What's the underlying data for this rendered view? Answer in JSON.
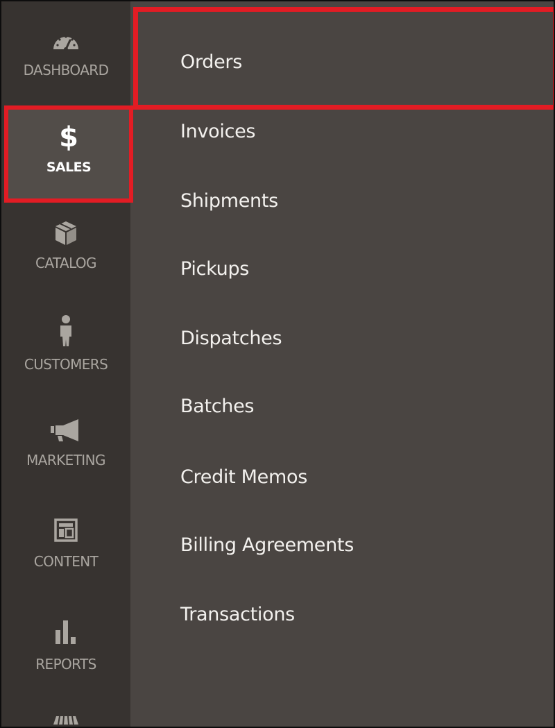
{
  "sidebar": {
    "items": [
      {
        "id": "dashboard",
        "label": "DASHBOARD",
        "icon": "speedometer-icon"
      },
      {
        "id": "sales",
        "label": "SALES",
        "icon": "dollar-icon",
        "active": true
      },
      {
        "id": "catalog",
        "label": "CATALOG",
        "icon": "cube-icon"
      },
      {
        "id": "customers",
        "label": "CUSTOMERS",
        "icon": "person-icon"
      },
      {
        "id": "marketing",
        "label": "MARKETING",
        "icon": "megaphone-icon"
      },
      {
        "id": "content",
        "label": "CONTENT",
        "icon": "layout-icon"
      },
      {
        "id": "reports",
        "label": "REPORTS",
        "icon": "bar-chart-icon"
      },
      {
        "id": "stores",
        "label": "",
        "icon": "storefront-icon"
      }
    ]
  },
  "submenu": {
    "items": [
      {
        "label": "Orders",
        "highlighted": true
      },
      {
        "label": "Invoices"
      },
      {
        "label": "Shipments"
      },
      {
        "label": "Pickups"
      },
      {
        "label": "Dispatches"
      },
      {
        "label": "Batches"
      },
      {
        "label": "Credit Memos"
      },
      {
        "label": "Billing Agreements"
      },
      {
        "label": "Transactions"
      }
    ]
  },
  "colors": {
    "highlight": "#e21c24",
    "sidebar_bg": "#373330",
    "panel_bg": "#4a4542",
    "active_bg": "#524d49",
    "text_muted": "#aaa6a0",
    "text_light": "#f3f1ee"
  }
}
